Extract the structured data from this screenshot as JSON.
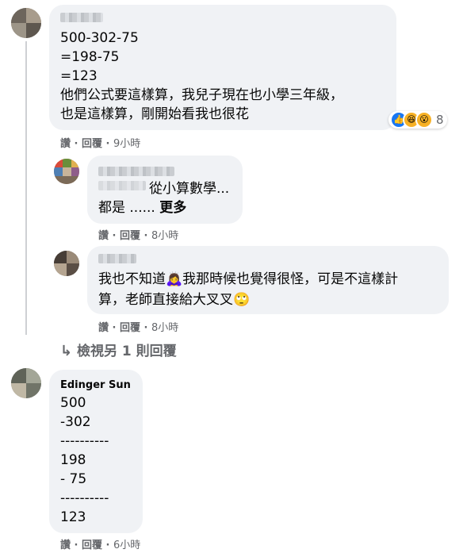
{
  "comments": [
    {
      "lines": [
        "500-302-75",
        "=198-75",
        "=123",
        "他們公式要這樣算，我兒子現在也小學三年級，",
        "也是這樣算，剛開始看我也很花"
      ],
      "reaction_count": "8",
      "actions": {
        "like": "讚",
        "reply": "回覆",
        "time": "9小時"
      }
    },
    {
      "lines": [
        "從小算數學...",
        "都是 ......"
      ],
      "more": "更多",
      "actions": {
        "like": "讚",
        "reply": "回覆",
        "time": "8小時"
      }
    },
    {
      "lines": [
        "我也不知道🙇‍♀️我那時候也覺得很怪，可是不這樣計",
        "算，老師直接給大叉叉🙄"
      ],
      "actions": {
        "like": "讚",
        "reply": "回覆",
        "time": "8小時"
      }
    },
    {
      "author": "Edinger Sun",
      "lines": [
        "500",
        "-302",
        "----------",
        "198",
        "- 75",
        "----------",
        "123"
      ],
      "actions": {
        "like": "讚",
        "reply": "回覆",
        "time": "6小時"
      }
    }
  ],
  "view_more_replies": "檢視另 1 則回覆",
  "icons": {
    "like": "like-reaction-icon",
    "haha": "haha-reaction-icon",
    "wow": "wow-reaction-icon",
    "reply_arrow": "reply-arrow-icon"
  },
  "colors": {
    "bubble": "#f0f2f5",
    "meta": "#65676b",
    "like_blue": "#1877f2"
  }
}
